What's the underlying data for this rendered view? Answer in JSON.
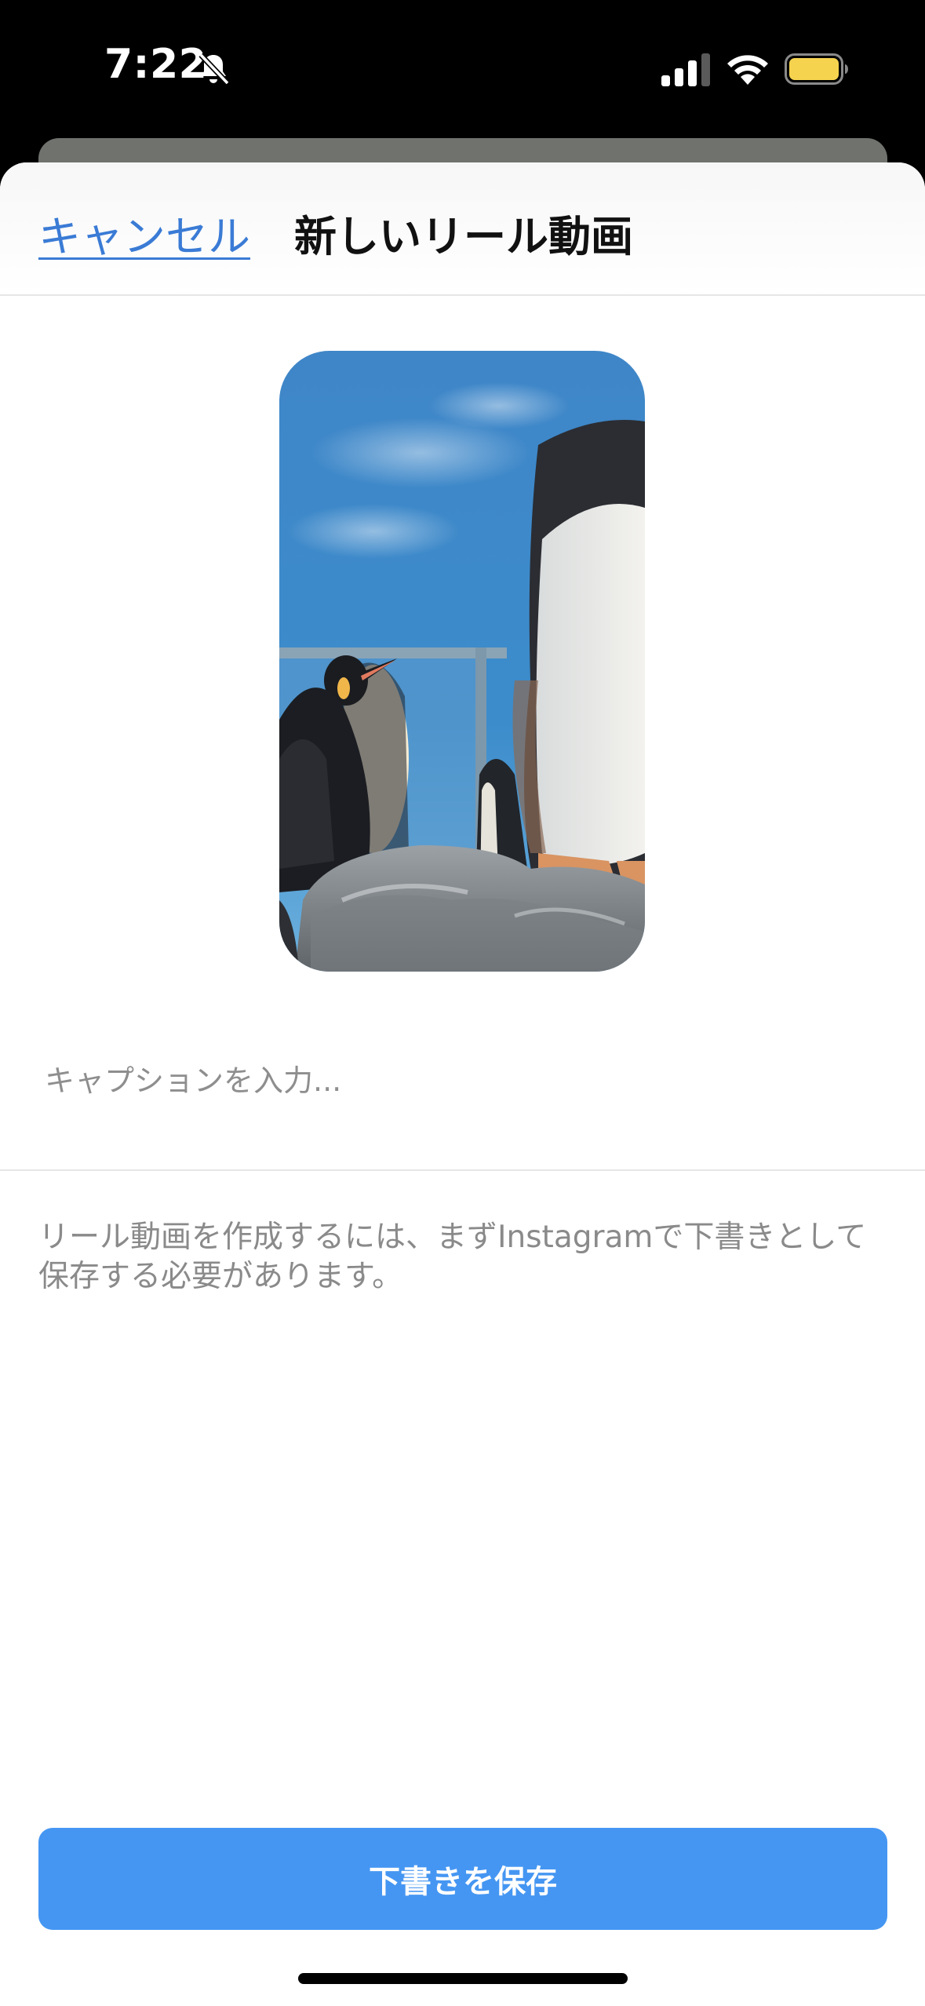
{
  "status_bar": {
    "time": "7:22",
    "silent_icon": "bell-slash-icon",
    "signal_icon": "cellular-signal-icon",
    "wifi_icon": "wifi-icon",
    "battery_icon": "battery-icon",
    "battery_color": "#f5d34f"
  },
  "nav": {
    "cancel_label": "キャンセル",
    "title": "新しいリール動画"
  },
  "preview": {
    "image": "penguins-video-thumbnail"
  },
  "caption": {
    "placeholder": "キャプションを入力...",
    "value": ""
  },
  "info": {
    "text": "リール動画を作成するには、まずInstagramで下書きとして保存する必要があります。"
  },
  "actions": {
    "save_draft_label": "下書きを保存"
  },
  "colors": {
    "accent": "#4596f2",
    "link": "#3a7bd5",
    "secondary_text": "#8a8a8a"
  }
}
